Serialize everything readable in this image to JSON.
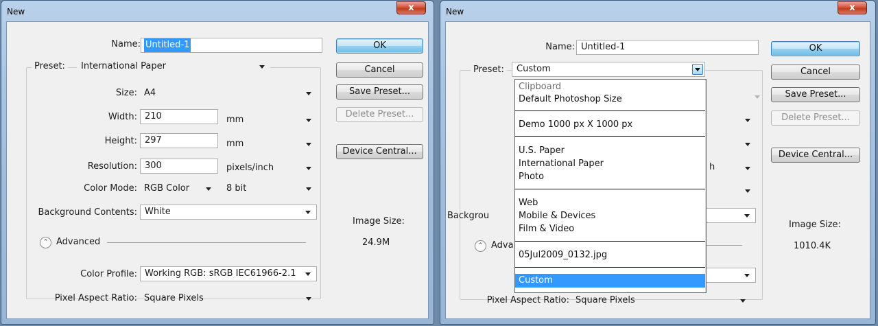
{
  "left": {
    "title": "New",
    "close_glyph": "x",
    "name_label": "Name:",
    "name_value": "Untitled-1",
    "preset_label": "Preset:",
    "preset_value": "International Paper",
    "size_label": "Size:",
    "size_value": "A4",
    "width_label": "Width:",
    "width_value": "210",
    "width_unit": "mm",
    "height_label": "Height:",
    "height_value": "297",
    "height_unit": "mm",
    "resolution_label": "Resolution:",
    "resolution_value": "300",
    "resolution_unit": "pixels/inch",
    "color_mode_label": "Color Mode:",
    "color_mode_value": "RGB Color",
    "bit_depth_value": "8 bit",
    "background_label": "Background Contents:",
    "background_value": "White",
    "advanced_label": "Advanced",
    "color_profile_label": "Color Profile:",
    "color_profile_value": "Working RGB:  sRGB IEC61966-2.1",
    "pixel_aspect_label": "Pixel Aspect Ratio:",
    "pixel_aspect_value": "Square Pixels",
    "image_size_label": "Image Size:",
    "image_size_value": "24.9M",
    "buttons": {
      "ok": "OK",
      "cancel": "Cancel",
      "save_preset": "Save Preset...",
      "delete_preset": "Delete Preset...",
      "device_central": "Device Central..."
    }
  },
  "right": {
    "title": "New",
    "close_glyph": "x",
    "name_label": "Name:",
    "name_value": "Untitled-1",
    "preset_label": "Preset:",
    "preset_value": "Custom",
    "background_label_partial": "Backgrou",
    "advanced_label_partial": "Adva",
    "resolution_unit_partial": "h",
    "pixel_aspect_label": "Pixel Aspect Ratio:",
    "pixel_aspect_value": "Square Pixels",
    "image_size_label": "Image Size:",
    "image_size_value": "1010.4K",
    "buttons": {
      "ok": "OK",
      "cancel": "Cancel",
      "save_preset": "Save Preset...",
      "delete_preset": "Delete Preset...",
      "device_central": "Device Central..."
    },
    "preset_menu": {
      "items": [
        "Clipboard",
        "Default Photoshop Size",
        "Demo 1000 px X 1000 px",
        "U.S. Paper",
        "International Paper",
        "Photo",
        "Web",
        "Mobile & Devices",
        "Film & Video",
        "05Jul2009_0132.jpg",
        "Custom"
      ],
      "selected": "Custom"
    }
  },
  "colors": {
    "selection": "#3399ff",
    "window_frame": "#a7c1df",
    "close_button": "#c23b1f"
  }
}
